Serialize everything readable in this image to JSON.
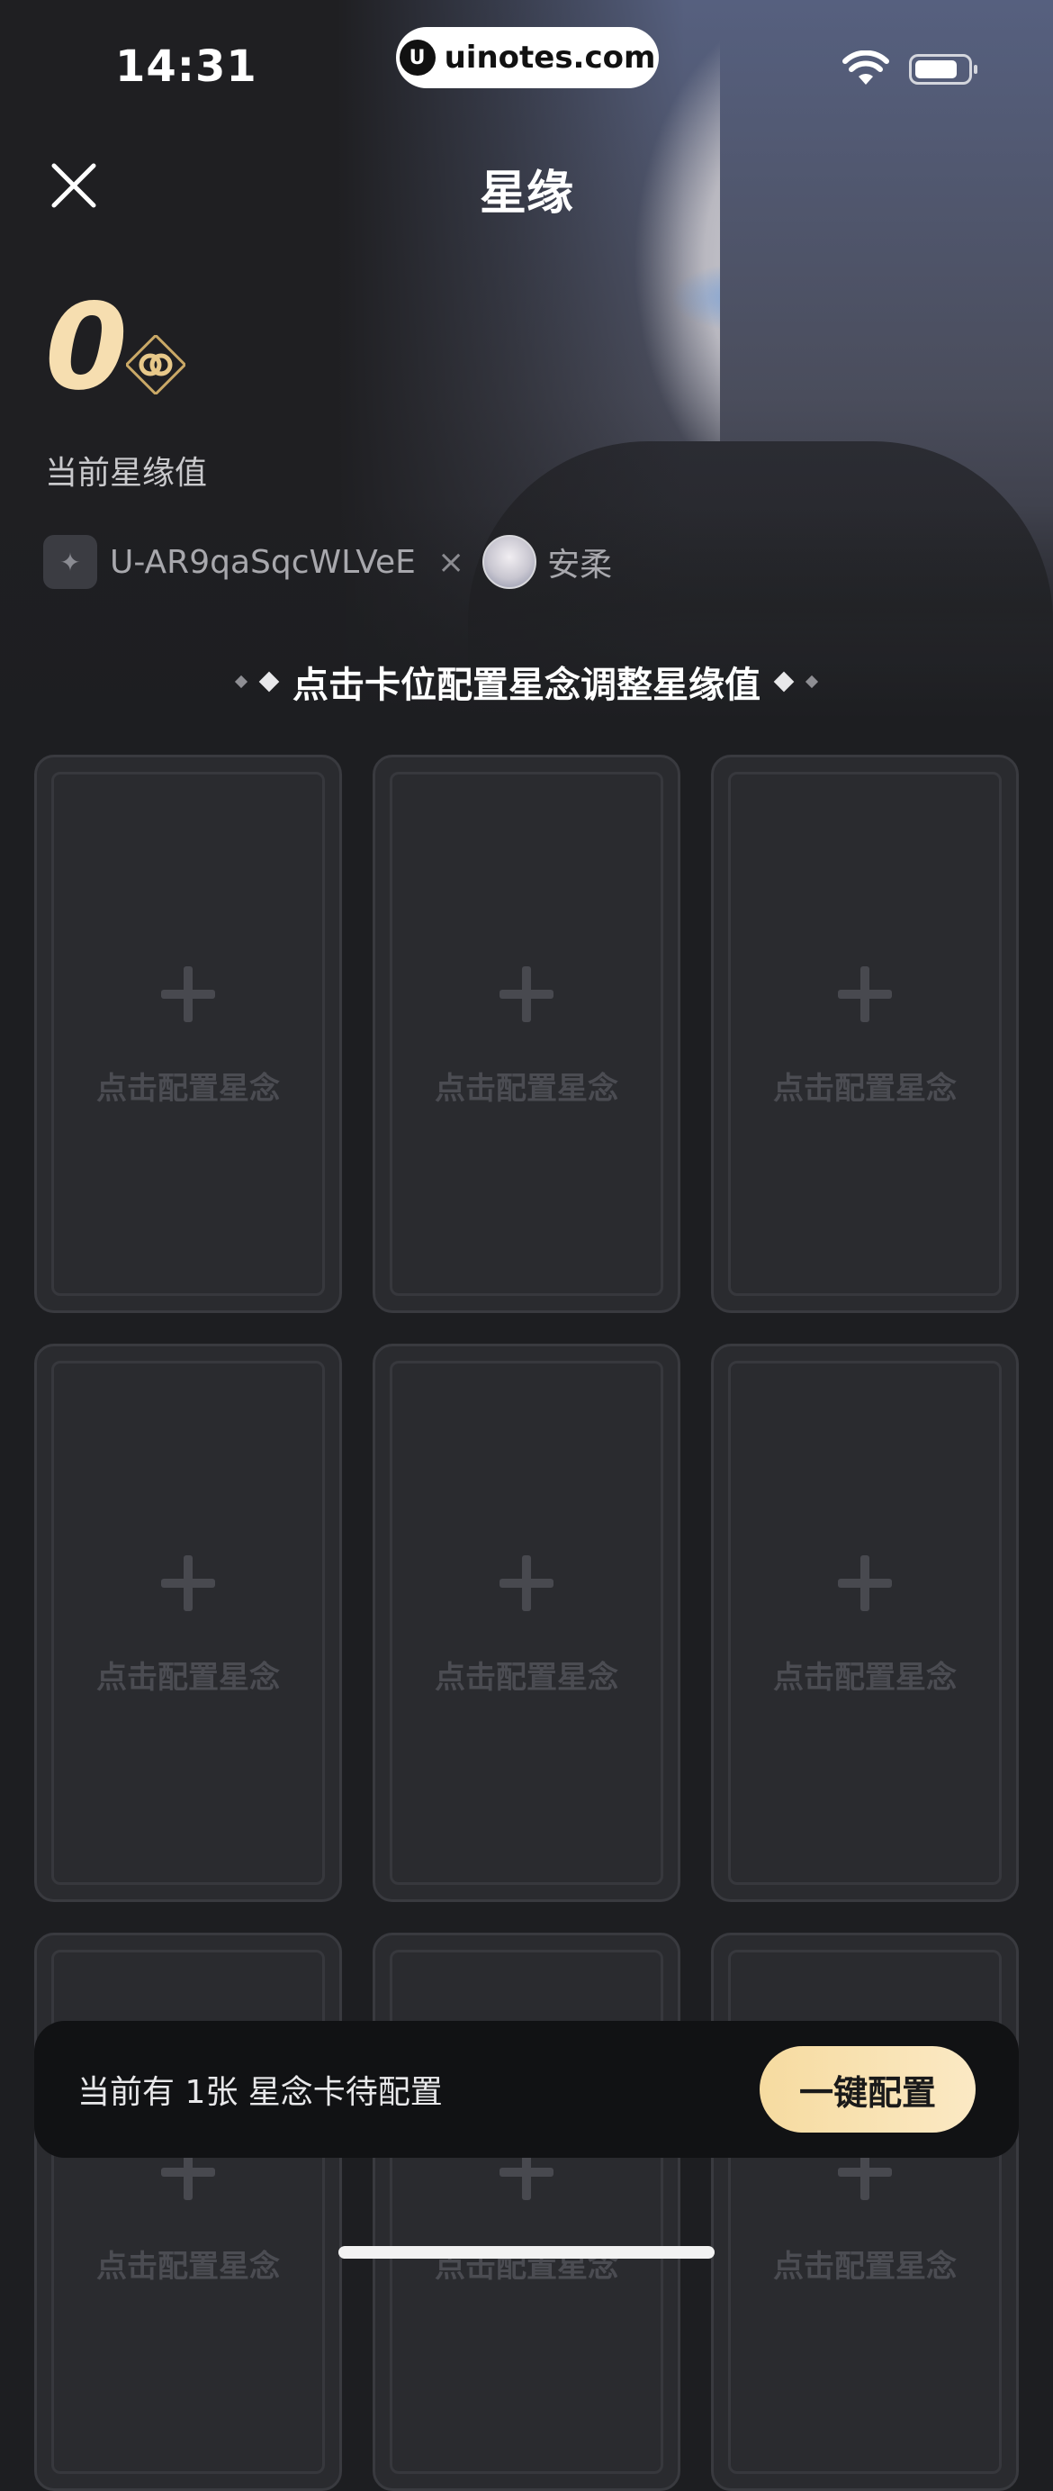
{
  "status_bar": {
    "time": "14:31"
  },
  "watermark": {
    "logo": "U",
    "text": "uinotes.com"
  },
  "header": {
    "title": "星缘"
  },
  "summary": {
    "value": "0",
    "label": "当前星缘值"
  },
  "pair": {
    "user_avatar_glyph": "✦",
    "user_name": "U-AR9qaSqcWLVeE",
    "separator": "×",
    "partner_name": "安柔"
  },
  "hint": {
    "text": "点击卡位配置星念调整星缘值"
  },
  "cards": [
    {
      "label": "点击配置星念"
    },
    {
      "label": "点击配置星念"
    },
    {
      "label": "点击配置星念"
    },
    {
      "label": "点击配置星念"
    },
    {
      "label": "点击配置星念"
    },
    {
      "label": "点击配置星念"
    },
    {
      "label": "点击配置星念"
    },
    {
      "label": "点击配置星念"
    },
    {
      "label": "点击配置星念"
    }
  ],
  "bottom_bar": {
    "text": "当前有 1张 星念卡待配置",
    "button_label": "一键配置"
  },
  "colors": {
    "accent_gold": "#f6deb0",
    "button_gold": "#f6dba0",
    "background": "#1d1e21",
    "card": "#2a2b2f"
  }
}
